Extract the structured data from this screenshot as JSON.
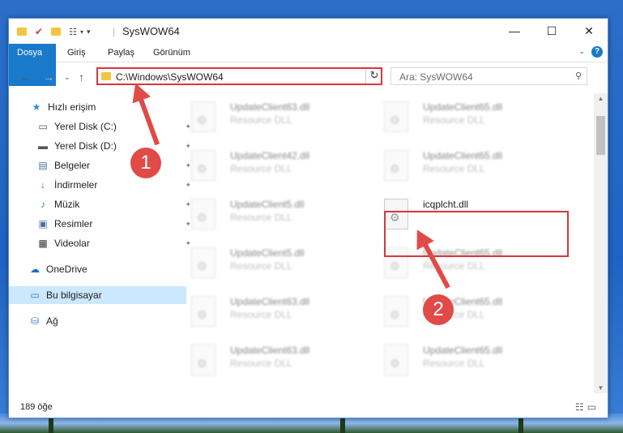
{
  "window": {
    "title": "SysWOW64",
    "controls": {
      "minimize": "—",
      "maximize": "☐",
      "close": "✕"
    }
  },
  "ribbon": {
    "tabs": [
      "Dosya",
      "Giriş",
      "Paylaş",
      "Görünüm"
    ],
    "help": "?"
  },
  "address": {
    "path": "C:\\Windows\\SysWOW64",
    "search_placeholder": "Ara: SysWOW64"
  },
  "sidebar": {
    "items": [
      {
        "label": "Hızlı erişim",
        "icon": "star-icon",
        "pinned": false
      },
      {
        "label": "Yerel Disk (C:)",
        "icon": "drive-icon",
        "pinned": true
      },
      {
        "label": "Yerel Disk (D:)",
        "icon": "drive-icon",
        "pinned": true
      },
      {
        "label": "Belgeler",
        "icon": "documents-icon",
        "pinned": true
      },
      {
        "label": "İndirmeler",
        "icon": "download-icon",
        "pinned": true
      },
      {
        "label": "Müzik",
        "icon": "music-icon",
        "pinned": true
      },
      {
        "label": "Resimler",
        "icon": "pictures-icon",
        "pinned": true
      },
      {
        "label": "Videolar",
        "icon": "videos-icon",
        "pinned": true
      },
      {
        "label": "OneDrive",
        "icon": "cloud-icon",
        "pinned": false
      },
      {
        "label": "Bu bilgisayar",
        "icon": "computer-icon",
        "pinned": false
      },
      {
        "label": "Ağ",
        "icon": "network-icon",
        "pinned": false
      }
    ]
  },
  "files": [
    {
      "name": "UpdateClient63.dll",
      "desc": "Resource DLL"
    },
    {
      "name": "UpdateClient65.dll",
      "desc": "Resource DLL"
    },
    {
      "name": "UpdateClient42.dll",
      "desc": "Resource DLL"
    },
    {
      "name": "UpdateClient65.dll",
      "desc": "Resource DLL"
    },
    {
      "name": "UpdateClient5.dll",
      "desc": "Resource DLL"
    },
    {
      "name": "icqplcht.dll",
      "desc": ""
    },
    {
      "name": "UpdateClient5.dll",
      "desc": "Resource DLL"
    },
    {
      "name": "UpdateClient65.dll",
      "desc": "Resource DLL"
    },
    {
      "name": "UpdateClient63.dll",
      "desc": "Resource DLL"
    },
    {
      "name": "UpdateClient65.dll",
      "desc": "Resource DLL"
    },
    {
      "name": "UpdateClient63.dll",
      "desc": "Resource DLL"
    },
    {
      "name": "UpdateClient65.dll",
      "desc": "Resource DLL"
    }
  ],
  "annotations": {
    "step1": "1",
    "step2": "2",
    "color": "#e14a46"
  },
  "status": {
    "count": "189 öğe"
  }
}
